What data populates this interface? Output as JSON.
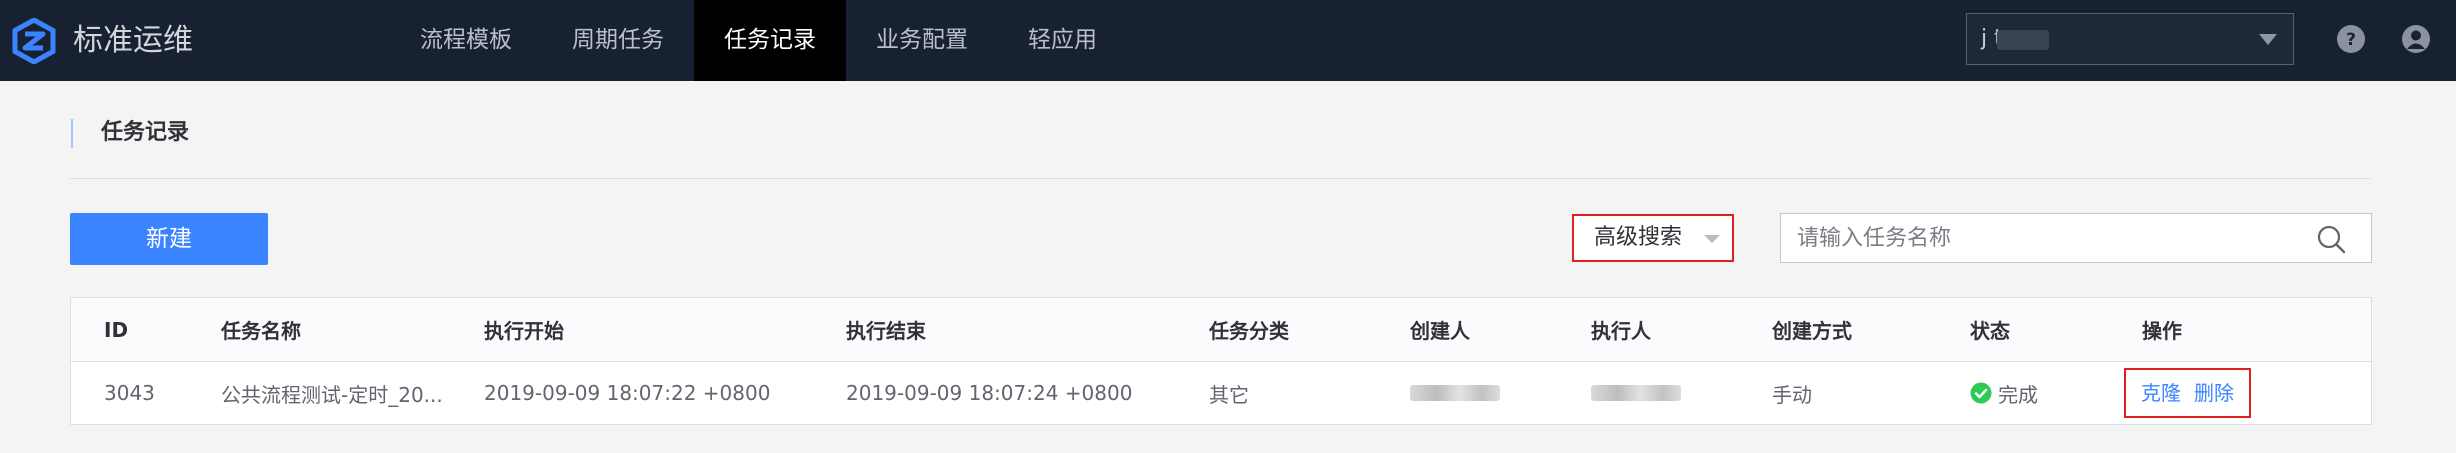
{
  "app": {
    "brand": "标准运维",
    "nav": [
      {
        "label": "流程模板"
      },
      {
        "label": "周期任务"
      },
      {
        "label": "任务记录",
        "active": true
      },
      {
        "label": "业务配置"
      },
      {
        "label": "轻应用"
      }
    ],
    "business_selector": {
      "value": "j      t"
    }
  },
  "page": {
    "title": "任务记录"
  },
  "toolbar": {
    "new_label": "新建",
    "advanced_search_label": "高级搜索",
    "search_placeholder": "请输入任务名称"
  },
  "table": {
    "columns": [
      "ID",
      "任务名称",
      "执行开始",
      "执行结束",
      "任务分类",
      "创建人",
      "执行人",
      "创建方式",
      "状态",
      "操作"
    ],
    "rows": [
      {
        "id": "3043",
        "name": "公共流程测试-定时_20...",
        "start": "2019-09-09 18:07:22 +0800",
        "end": "2019-09-09 18:07:24 +0800",
        "category": "其它",
        "creator": "",
        "executor": "",
        "create_method": "手动",
        "status": "完成",
        "actions": {
          "clone": "克隆",
          "delete": "删除"
        }
      }
    ]
  },
  "colors": {
    "topbar": "#182132",
    "primary": "#3a84ff",
    "success": "#2dcb56",
    "highlight_border": "#e02020"
  },
  "icons": {
    "logo": "logo-icon",
    "help": "help-icon",
    "user": "user-icon",
    "search": "search-icon",
    "status": "success-check-icon"
  }
}
